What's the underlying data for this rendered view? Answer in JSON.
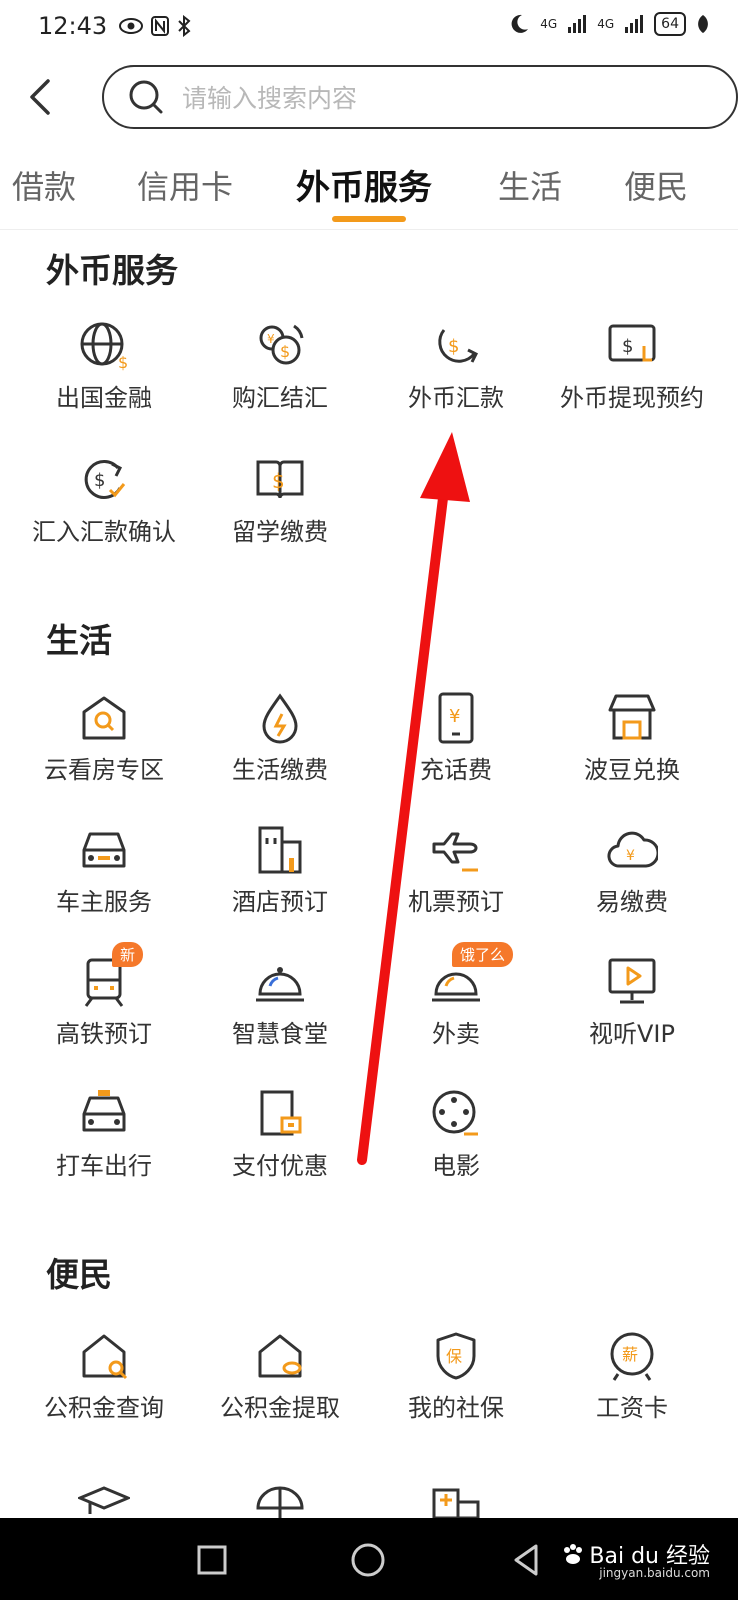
{
  "status_bar": {
    "time": "12:43",
    "battery": "64",
    "signal": "4G"
  },
  "search": {
    "placeholder": "请输入搜索内容"
  },
  "tabs": [
    "借款",
    "信用卡",
    "外币服务",
    "生活",
    "便民"
  ],
  "active_tab": "外币服务",
  "accent_color": "#f39a1b",
  "sections": {
    "forex": {
      "title": "外币服务",
      "items": [
        "出国金融",
        "购汇结汇",
        "外币汇款",
        "外币提现预约",
        "汇入汇款确认",
        "留学缴费"
      ]
    },
    "life": {
      "title": "生活",
      "items": [
        "云看房专区",
        "生活缴费",
        "充话费",
        "波豆兑换",
        "车主服务",
        "酒店预订",
        "机票预订",
        "易缴费",
        "高铁预订",
        "智慧食堂",
        "外卖",
        "视听VIP",
        "打车出行",
        "支付优惠",
        "电影"
      ],
      "badges": {
        "new": "新",
        "eleme": "饿了么"
      }
    },
    "convenience": {
      "title": "便民",
      "items": [
        "公积金查询",
        "公积金提取",
        "我的社保",
        "工资卡"
      ]
    }
  },
  "watermark": {
    "brand": "Bai du 经验",
    "url": "jingyan.baidu.com"
  }
}
